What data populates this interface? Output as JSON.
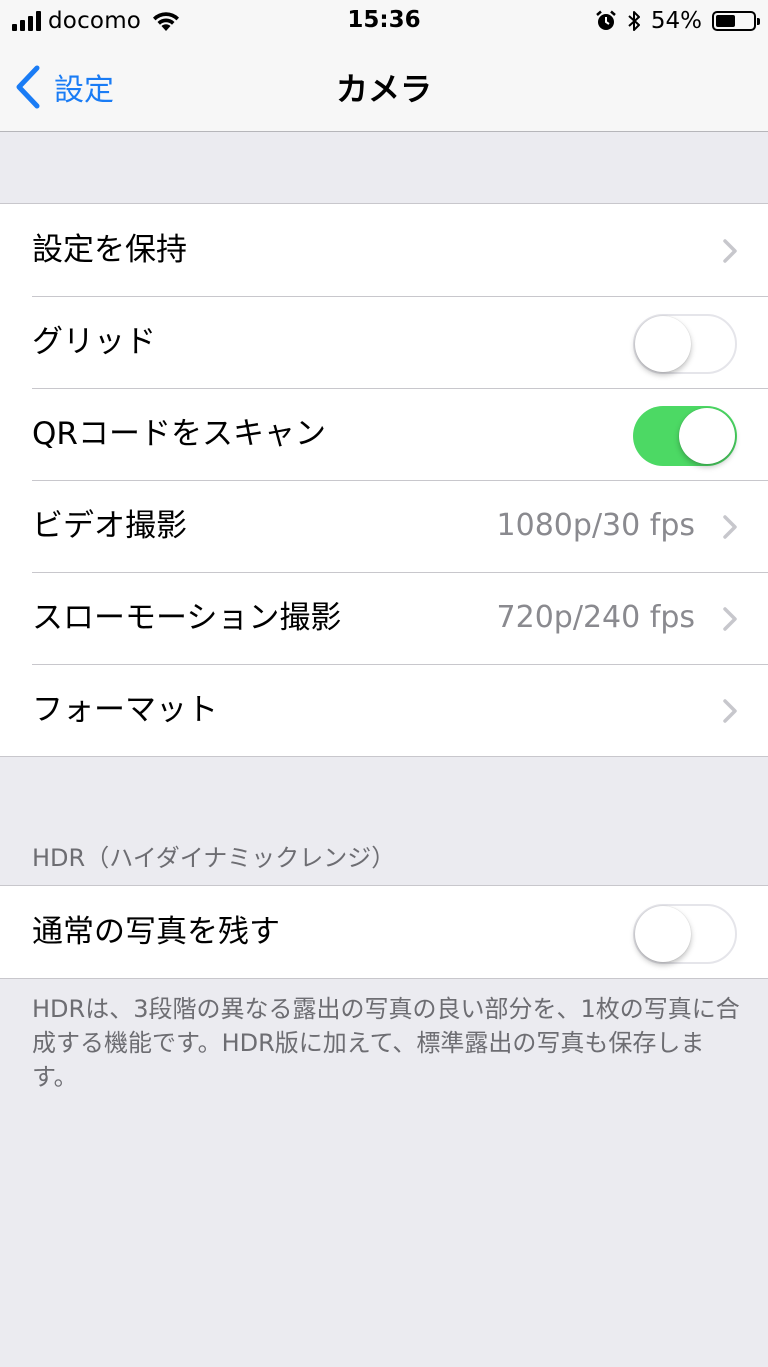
{
  "status_bar": {
    "carrier": "docomo",
    "time": "15:36",
    "battery_percent_text": "54%",
    "battery_level": 0.54,
    "icons": [
      "signal-icon",
      "wifi-icon",
      "alarm-icon",
      "bluetooth-icon",
      "battery-icon"
    ]
  },
  "nav": {
    "back_label": "設定",
    "title": "カメラ"
  },
  "group1": {
    "rows": [
      {
        "label": "設定を保持",
        "type": "disclosure"
      },
      {
        "label": "グリッド",
        "type": "toggle",
        "on": false
      },
      {
        "label": "QRコードをスキャン",
        "type": "toggle",
        "on": true
      },
      {
        "label": "ビデオ撮影",
        "value": "1080p/30 fps",
        "type": "disclosure"
      },
      {
        "label": "スローモーション撮影",
        "value": "720p/240 fps",
        "type": "disclosure"
      },
      {
        "label": "フォーマット",
        "type": "disclosure"
      }
    ]
  },
  "hdr_section": {
    "header": "HDR（ハイダイナミックレンジ）",
    "rows": [
      {
        "label": "通常の写真を残す",
        "type": "toggle",
        "on": false
      }
    ],
    "footer": "HDRは、3段階の異なる露出の写真の良い部分を、1枚の写真に合成する機能です。HDR版に加えて、標準露出の写真も保存します。"
  },
  "colors": {
    "accent_blue": "#1a7cf5",
    "toggle_on_green": "#4cd964",
    "background": "#ebebf0",
    "secondary_text": "#8a8a8f"
  }
}
